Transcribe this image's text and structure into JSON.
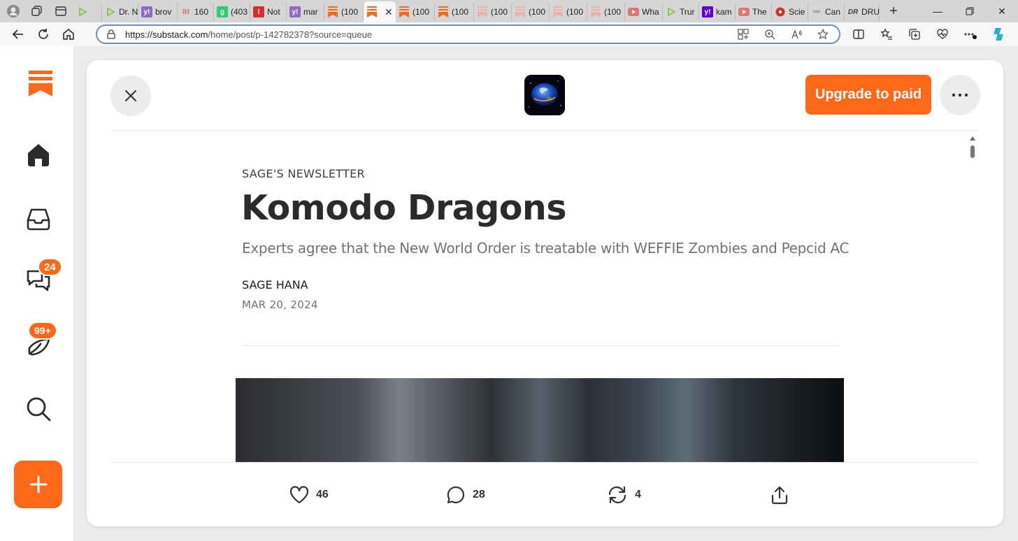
{
  "browser": {
    "tabs": [
      {
        "label": "",
        "favicon": "play-icon",
        "color": "#8bc34a"
      },
      {
        "label": "Dr. N",
        "favicon": "play-icon",
        "color": "#8bc34a"
      },
      {
        "label": "brov",
        "favicon": "y!",
        "color": "#8e6bc4"
      },
      {
        "label": "160",
        "favicon": "BI",
        "color": "#e8b3a8"
      },
      {
        "label": "(403",
        "favicon": "g",
        "color": "#2ecc71"
      },
      {
        "label": "Not",
        "favicon": "!",
        "color": "#d32f2f"
      },
      {
        "label": "mar",
        "favicon": "y!",
        "color": "#8e6bc4"
      },
      {
        "label": "(100",
        "favicon": "substack",
        "color": "#ff6719"
      },
      {
        "label": "",
        "favicon": "substack",
        "color": "#ff6719",
        "active": true
      },
      {
        "label": "(100",
        "favicon": "substack",
        "color": "#ff6719"
      },
      {
        "label": "(100",
        "favicon": "substack",
        "color": "#ff6719"
      },
      {
        "label": "(100",
        "favicon": "substack",
        "color": "#e8b3a8"
      },
      {
        "label": "(100",
        "favicon": "substack",
        "color": "#e8b3a8"
      },
      {
        "label": "(100",
        "favicon": "substack",
        "color": "#e8b3a8"
      },
      {
        "label": "(100",
        "favicon": "substack",
        "color": "#e8b3a8"
      },
      {
        "label": "Wha",
        "favicon": "youtube",
        "color": "#e57373"
      },
      {
        "label": "Trur",
        "favicon": "play-icon",
        "color": "#8bc34a"
      },
      {
        "label": "kam",
        "favicon": "y!",
        "color": "#5f01d1"
      },
      {
        "label": "The",
        "favicon": "youtube",
        "color": "#e57373"
      },
      {
        "label": "Scie",
        "favicon": "cbc",
        "color": "#d32f2f"
      },
      {
        "label": "Can",
        "favicon": "aaa",
        "color": "#9e9e9e"
      },
      {
        "label": "DRU",
        "favicon": "DR",
        "color": "#555555"
      }
    ],
    "url_host": "https://substack.com",
    "url_path": "/home/post/p-142782378?source=queue"
  },
  "nav": {
    "chat_badge": "24",
    "activity_badge": "99+"
  },
  "post": {
    "publication": "SAGE'S NEWSLETTER",
    "title": "Komodo Dragons",
    "subtitle": "Experts agree that the New World Order is treatable with WEFFIE Zombies and Pepcid AC",
    "author": "SAGE HANA",
    "date": "MAR 20, 2024",
    "upgrade_label": "Upgrade to paid"
  },
  "actions": {
    "likes": "46",
    "comments": "28",
    "restacks": "4"
  },
  "colors": {
    "accent": "#ff6719"
  }
}
